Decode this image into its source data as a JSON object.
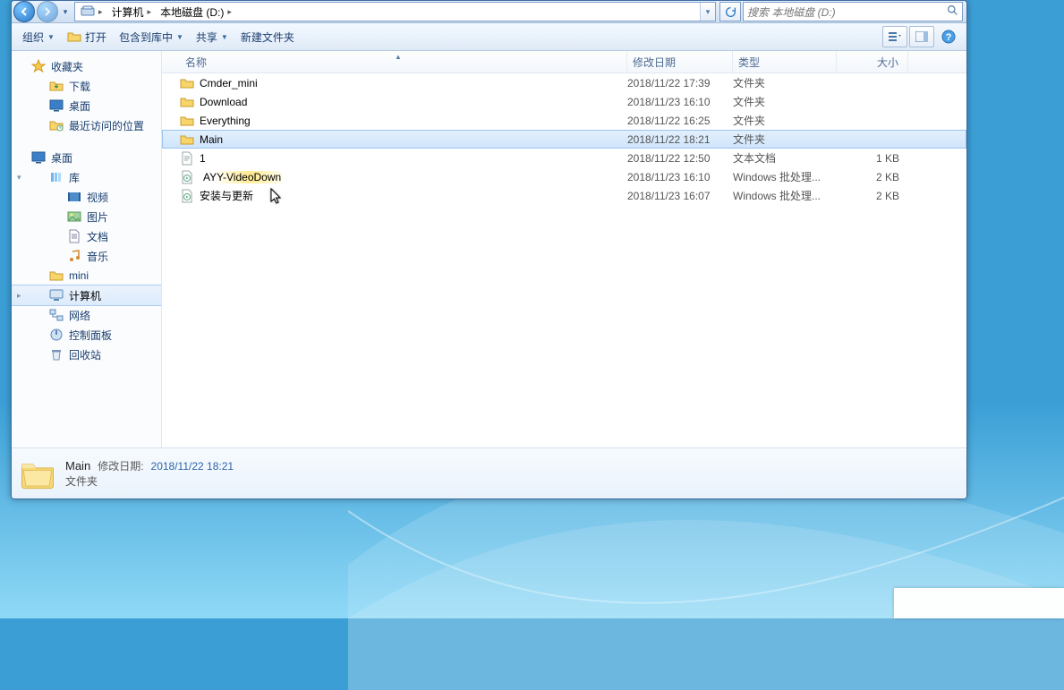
{
  "addressbar": {
    "segments": [
      "计算机",
      "本地磁盘 (D:)"
    ],
    "search_placeholder": "搜索 本地磁盘 (D:)"
  },
  "toolbar": {
    "organize": "组织",
    "open": "打开",
    "include": "包含到库中",
    "share": "共享",
    "newfolder": "新建文件夹"
  },
  "columns": {
    "name": "名称",
    "date": "修改日期",
    "type": "类型",
    "size": "大小"
  },
  "nav": {
    "favorites": {
      "label": "收藏夹",
      "items": [
        {
          "label": "下载"
        },
        {
          "label": "桌面"
        },
        {
          "label": "最近访问的位置"
        }
      ]
    },
    "desktop": {
      "label": "桌面",
      "items": [
        {
          "label": "库",
          "children": [
            {
              "label": "视频"
            },
            {
              "label": "图片"
            },
            {
              "label": "文档"
            },
            {
              "label": "音乐"
            }
          ]
        },
        {
          "label": "mini"
        },
        {
          "label": "计算机",
          "selected": true
        },
        {
          "label": "网络"
        },
        {
          "label": "控制面板"
        },
        {
          "label": "回收站"
        }
      ]
    }
  },
  "files": [
    {
      "name": "Cmder_mini",
      "date": "2018/11/22 17:39",
      "type": "文件夹",
      "size": "",
      "icon": "folder"
    },
    {
      "name": "Download",
      "date": "2018/11/23 16:10",
      "type": "文件夹",
      "size": "",
      "icon": "folder"
    },
    {
      "name": "Everything",
      "date": "2018/11/22 16:25",
      "type": "文件夹",
      "size": "",
      "icon": "folder"
    },
    {
      "name": "Main",
      "date": "2018/11/22 18:21",
      "type": "文件夹",
      "size": "",
      "icon": "folder",
      "selected": true
    },
    {
      "name": "1",
      "date": "2018/11/22 12:50",
      "type": "文本文档",
      "size": "1 KB",
      "icon": "txt"
    },
    {
      "name": "AYY-VideoDown",
      "date": "2018/11/23 16:10",
      "type": "Windows 批处理...",
      "size": "2 KB",
      "icon": "bat",
      "hover": true
    },
    {
      "name": "安装与更新",
      "date": "2018/11/23 16:07",
      "type": "Windows 批处理...",
      "size": "2 KB",
      "icon": "bat"
    }
  ],
  "details": {
    "name": "Main",
    "date_label": "修改日期:",
    "date": "2018/11/22 18:21",
    "type": "文件夹"
  }
}
